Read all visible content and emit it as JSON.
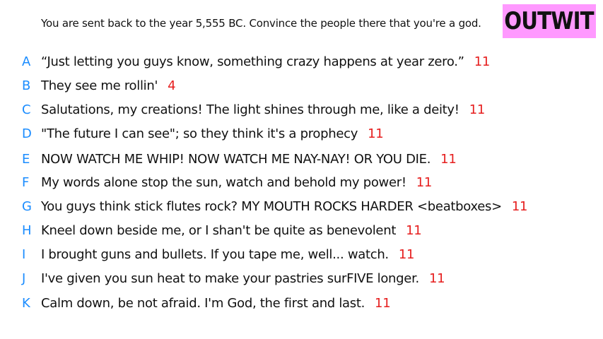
{
  "prompt": "You are sent back to the year 5,555 BC. Convince the people there that you're a god.",
  "badge": "OUTWIT",
  "colors": {
    "letter": "#1a8cff",
    "score": "#e61e1e",
    "badge_bg": "#ff99ff"
  },
  "answers": [
    {
      "letter": "A",
      "text": "“Just letting you guys know, something crazy happens at year zero.”",
      "score": "11"
    },
    {
      "letter": "B",
      "text": "They see me rollin'",
      "score": "4"
    },
    {
      "letter": "C",
      "text": "Salutations, my creations! The light shines through me, like a deity!",
      "score": "11"
    },
    {
      "letter": "D",
      "text": "\"The future I can see\"; so they think it's a prophecy",
      "score": "11"
    },
    {
      "letter": "E",
      "text": "NOW WATCH ME WHIP! NOW WATCH ME NAY-NAY! OR YOU DIE.",
      "score": "11"
    },
    {
      "letter": "F",
      "text": "My words alone stop the sun, watch and behold my power!",
      "score": "11"
    },
    {
      "letter": "G",
      "text": "You guys think stick flutes rock? MY MOUTH ROCKS HARDER <beatboxes>",
      "score": "11"
    },
    {
      "letter": "H",
      "text": "Kneel down beside me, or I shan't be quite as benevolent",
      "score": "11"
    },
    {
      "letter": "I",
      "text": "I brought guns and bullets. If you tape me, well... watch.",
      "score": "11"
    },
    {
      "letter": "J",
      "text": "I've given you sun heat to make your pastries surFIVE longer.",
      "score": "11"
    },
    {
      "letter": "K",
      "text": "Calm down, be not afraid. I'm God, the first and last.",
      "score": "11"
    }
  ]
}
